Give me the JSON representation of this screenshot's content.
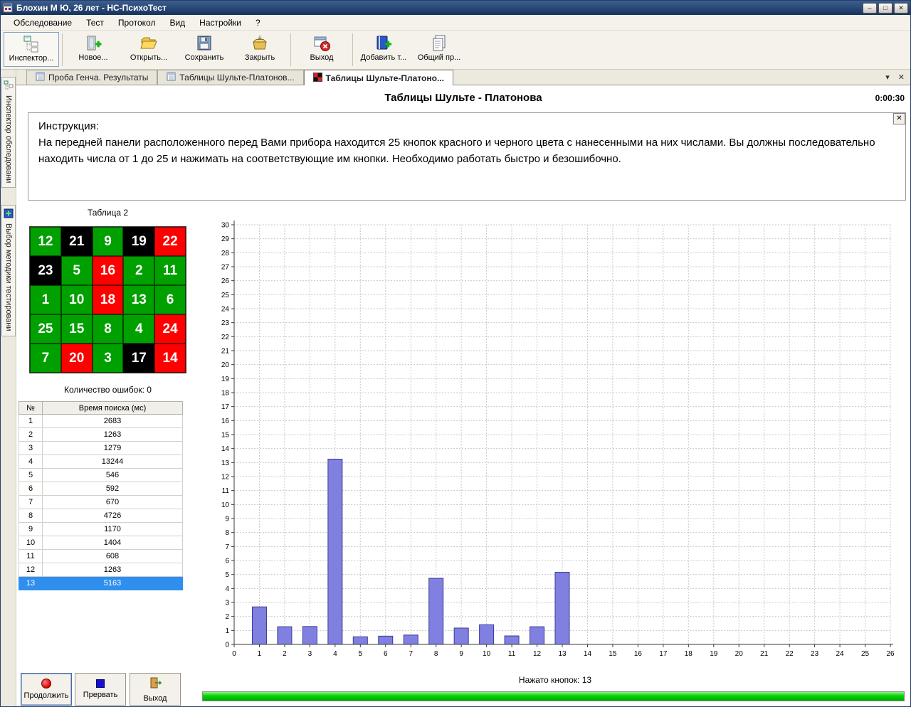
{
  "window": {
    "title": "Блохин М Ю, 26 лет - НС-ПсихоТест",
    "controls": {
      "minimize": "–",
      "maximize": "□",
      "close": "✕"
    }
  },
  "glyphs": {
    "dropdown": "▾",
    "close": "✕"
  },
  "menu": {
    "items": [
      {
        "label": "Обследование"
      },
      {
        "label": "Тест"
      },
      {
        "label": "Протокол"
      },
      {
        "label": "Вид"
      },
      {
        "label": "Настройки"
      },
      {
        "label": "?"
      }
    ]
  },
  "toolbar": {
    "items": [
      {
        "label": "Инспектор...",
        "icon": "inspector-icon"
      },
      {
        "label": "Новое...",
        "icon": "new-exam-icon"
      },
      {
        "label": "Открыть...",
        "icon": "open-folder-icon"
      },
      {
        "label": "Сохранить",
        "icon": "save-floppy-icon"
      },
      {
        "label": "Закрыть",
        "icon": "close-box-icon"
      },
      {
        "label": "Выход",
        "icon": "exit-window-icon"
      },
      {
        "label": "Добавить т...",
        "icon": "add-test-icon"
      },
      {
        "label": "Общий пр...",
        "icon": "protocol-doc-icon"
      }
    ]
  },
  "doc_tabs": {
    "items": [
      {
        "label": "Проба Генча. Результаты",
        "active": false
      },
      {
        "label": "Таблицы Шульте-Платонов...",
        "active": false
      },
      {
        "label": "Таблицы Шульте-Платоно...",
        "active": true
      }
    ]
  },
  "side_tabs": {
    "items": [
      {
        "label": "Инспектор обследовани"
      },
      {
        "label": "Выбор методики тестировани"
      }
    ]
  },
  "test": {
    "title": "Таблицы Шульте - Платонова",
    "timer": "0:00:30",
    "instruction_label": "Инструкция:",
    "instruction_text": "На передней панели расположенного перед Вами прибора находится 25 кнопок красного и черного цвета с нанесенными на них числами. Вы должны последовательно находить числа от 1 до 25 и нажимать на соответствующие им кнопки. Необходимо работать быстро и безошибочно.",
    "table_label": "Таблица 2",
    "errors_label": "Количество ошибок: 0"
  },
  "schulte_grid": {
    "colors": {
      "green": "#00a000",
      "black": "#000000",
      "red": "#ff0000",
      "text": "#ffffff"
    },
    "cells": [
      {
        "number": 12,
        "color": "green"
      },
      {
        "number": 21,
        "color": "black"
      },
      {
        "number": 9,
        "color": "green"
      },
      {
        "number": 19,
        "color": "black"
      },
      {
        "number": 22,
        "color": "red"
      },
      {
        "number": 23,
        "color": "black"
      },
      {
        "number": 5,
        "color": "green"
      },
      {
        "number": 16,
        "color": "red"
      },
      {
        "number": 2,
        "color": "green"
      },
      {
        "number": 11,
        "color": "green"
      },
      {
        "number": 1,
        "color": "green"
      },
      {
        "number": 10,
        "color": "green"
      },
      {
        "number": 18,
        "color": "red"
      },
      {
        "number": 13,
        "color": "green"
      },
      {
        "number": 6,
        "color": "green"
      },
      {
        "number": 25,
        "color": "green"
      },
      {
        "number": 15,
        "color": "green"
      },
      {
        "number": 8,
        "color": "green"
      },
      {
        "number": 4,
        "color": "green"
      },
      {
        "number": 24,
        "color": "red"
      },
      {
        "number": 7,
        "color": "green"
      },
      {
        "number": 20,
        "color": "red"
      },
      {
        "number": 3,
        "color": "green"
      },
      {
        "number": 17,
        "color": "black"
      },
      {
        "number": 14,
        "color": "red"
      }
    ]
  },
  "results_table": {
    "headers": [
      "№",
      "Время поиска (мс)"
    ],
    "rows": [
      [
        1,
        2683
      ],
      [
        2,
        1263
      ],
      [
        3,
        1279
      ],
      [
        4,
        13244
      ],
      [
        5,
        546
      ],
      [
        6,
        592
      ],
      [
        7,
        670
      ],
      [
        8,
        4726
      ],
      [
        9,
        1170
      ],
      [
        10,
        1404
      ],
      [
        11,
        608
      ],
      [
        12,
        1263
      ],
      [
        13,
        5163
      ]
    ],
    "selected_row": 13
  },
  "chart_data": {
    "type": "bar",
    "title": "",
    "xlabel": "",
    "ylabel": "",
    "x": [
      1,
      2,
      3,
      4,
      5,
      6,
      7,
      8,
      9,
      10,
      11,
      12,
      13
    ],
    "values": [
      2.683,
      1.263,
      1.279,
      13.244,
      0.546,
      0.592,
      0.67,
      4.726,
      1.17,
      1.404,
      0.608,
      1.263,
      5.163
    ],
    "xlim": [
      0,
      26
    ],
    "ylim": [
      0,
      30
    ],
    "x_tick_step": 1,
    "y_tick_step": 1,
    "grid": true,
    "grid_style": "dashed",
    "legend": false,
    "bar_color": "#8080e0",
    "bar_border_color": "#3a3a9a"
  },
  "footer": {
    "status": "Нажато кнопок: 13",
    "progress_percent": 100,
    "buttons": [
      {
        "label": "Продолжить",
        "icon": "record-red-circle-icon"
      },
      {
        "label": "Прервать",
        "icon": "stop-blue-square-icon"
      },
      {
        "label": "Выход",
        "icon": "exit-door-icon"
      }
    ]
  }
}
